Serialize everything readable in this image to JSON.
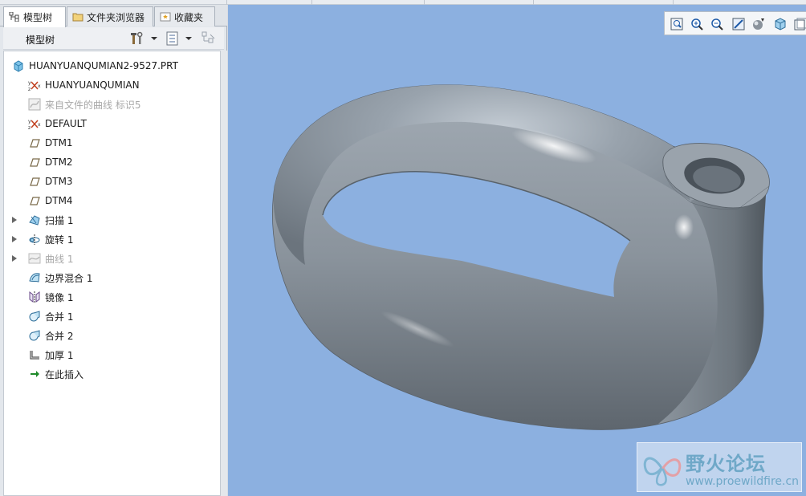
{
  "tabs": [
    {
      "label": "模型树",
      "icon": "model-tree-icon"
    },
    {
      "label": "文件夹浏览器",
      "icon": "folder-icon"
    },
    {
      "label": "收藏夹",
      "icon": "favorites-icon"
    }
  ],
  "toolbar": {
    "title": "模型树",
    "settings_icon": "tools-settings-icon",
    "show_icon": "tree-columns-icon",
    "filter_icon": "tree-filter-icon"
  },
  "tree": {
    "root": {
      "label": "HUANYUANQUMIAN2-9527.PRT",
      "icon": "part-icon"
    },
    "items": [
      {
        "label": "HUANYUANQUMIAN",
        "icon": "coordinate-system-icon",
        "expandable": false,
        "dim": false
      },
      {
        "label": "来自文件的曲线 标识5",
        "icon": "curve-from-file-icon",
        "expandable": false,
        "dim": true
      },
      {
        "label": "DEFAULT",
        "icon": "coordinate-system-icon",
        "expandable": false,
        "dim": false
      },
      {
        "label": "DTM1",
        "icon": "datum-plane-icon",
        "expandable": false,
        "dim": false
      },
      {
        "label": "DTM2",
        "icon": "datum-plane-icon",
        "expandable": false,
        "dim": false
      },
      {
        "label": "DTM3",
        "icon": "datum-plane-icon",
        "expandable": false,
        "dim": false
      },
      {
        "label": "DTM4",
        "icon": "datum-plane-icon",
        "expandable": false,
        "dim": false
      },
      {
        "label": "扫描 1",
        "icon": "sweep-icon",
        "expandable": true,
        "dim": false
      },
      {
        "label": "旋转 1",
        "icon": "revolve-icon",
        "expandable": true,
        "dim": false
      },
      {
        "label": "曲线 1",
        "icon": "curve-icon",
        "expandable": true,
        "dim": true
      },
      {
        "label": "边界混合 1",
        "icon": "boundary-blend-icon",
        "expandable": false,
        "dim": false
      },
      {
        "label": "镜像 1",
        "icon": "mirror-icon",
        "expandable": false,
        "dim": false
      },
      {
        "label": "合并 1",
        "icon": "merge-icon",
        "expandable": false,
        "dim": false
      },
      {
        "label": "合并 2",
        "icon": "merge-icon",
        "expandable": false,
        "dim": false
      },
      {
        "label": "加厚 1",
        "icon": "thicken-icon",
        "expandable": false,
        "dim": false
      },
      {
        "label": "在此插入",
        "icon": "insert-here-arrow-icon",
        "expandable": false,
        "dim": false
      }
    ]
  },
  "view_toolbar": {
    "buttons": [
      "refit-icon",
      "zoom-in-icon",
      "zoom-out-icon",
      "repaint-icon",
      "shading-icon",
      "saved-views-icon",
      "display-style-icon"
    ]
  },
  "watermark": {
    "title": "野火论坛",
    "url": "www.proewildfire.cn"
  },
  "colors": {
    "viewport_bg": "#8cb0e0",
    "model_gray": "#8a939c",
    "panel_bg": "#e3e7ec",
    "watermark_text": "#6fa8c8"
  }
}
